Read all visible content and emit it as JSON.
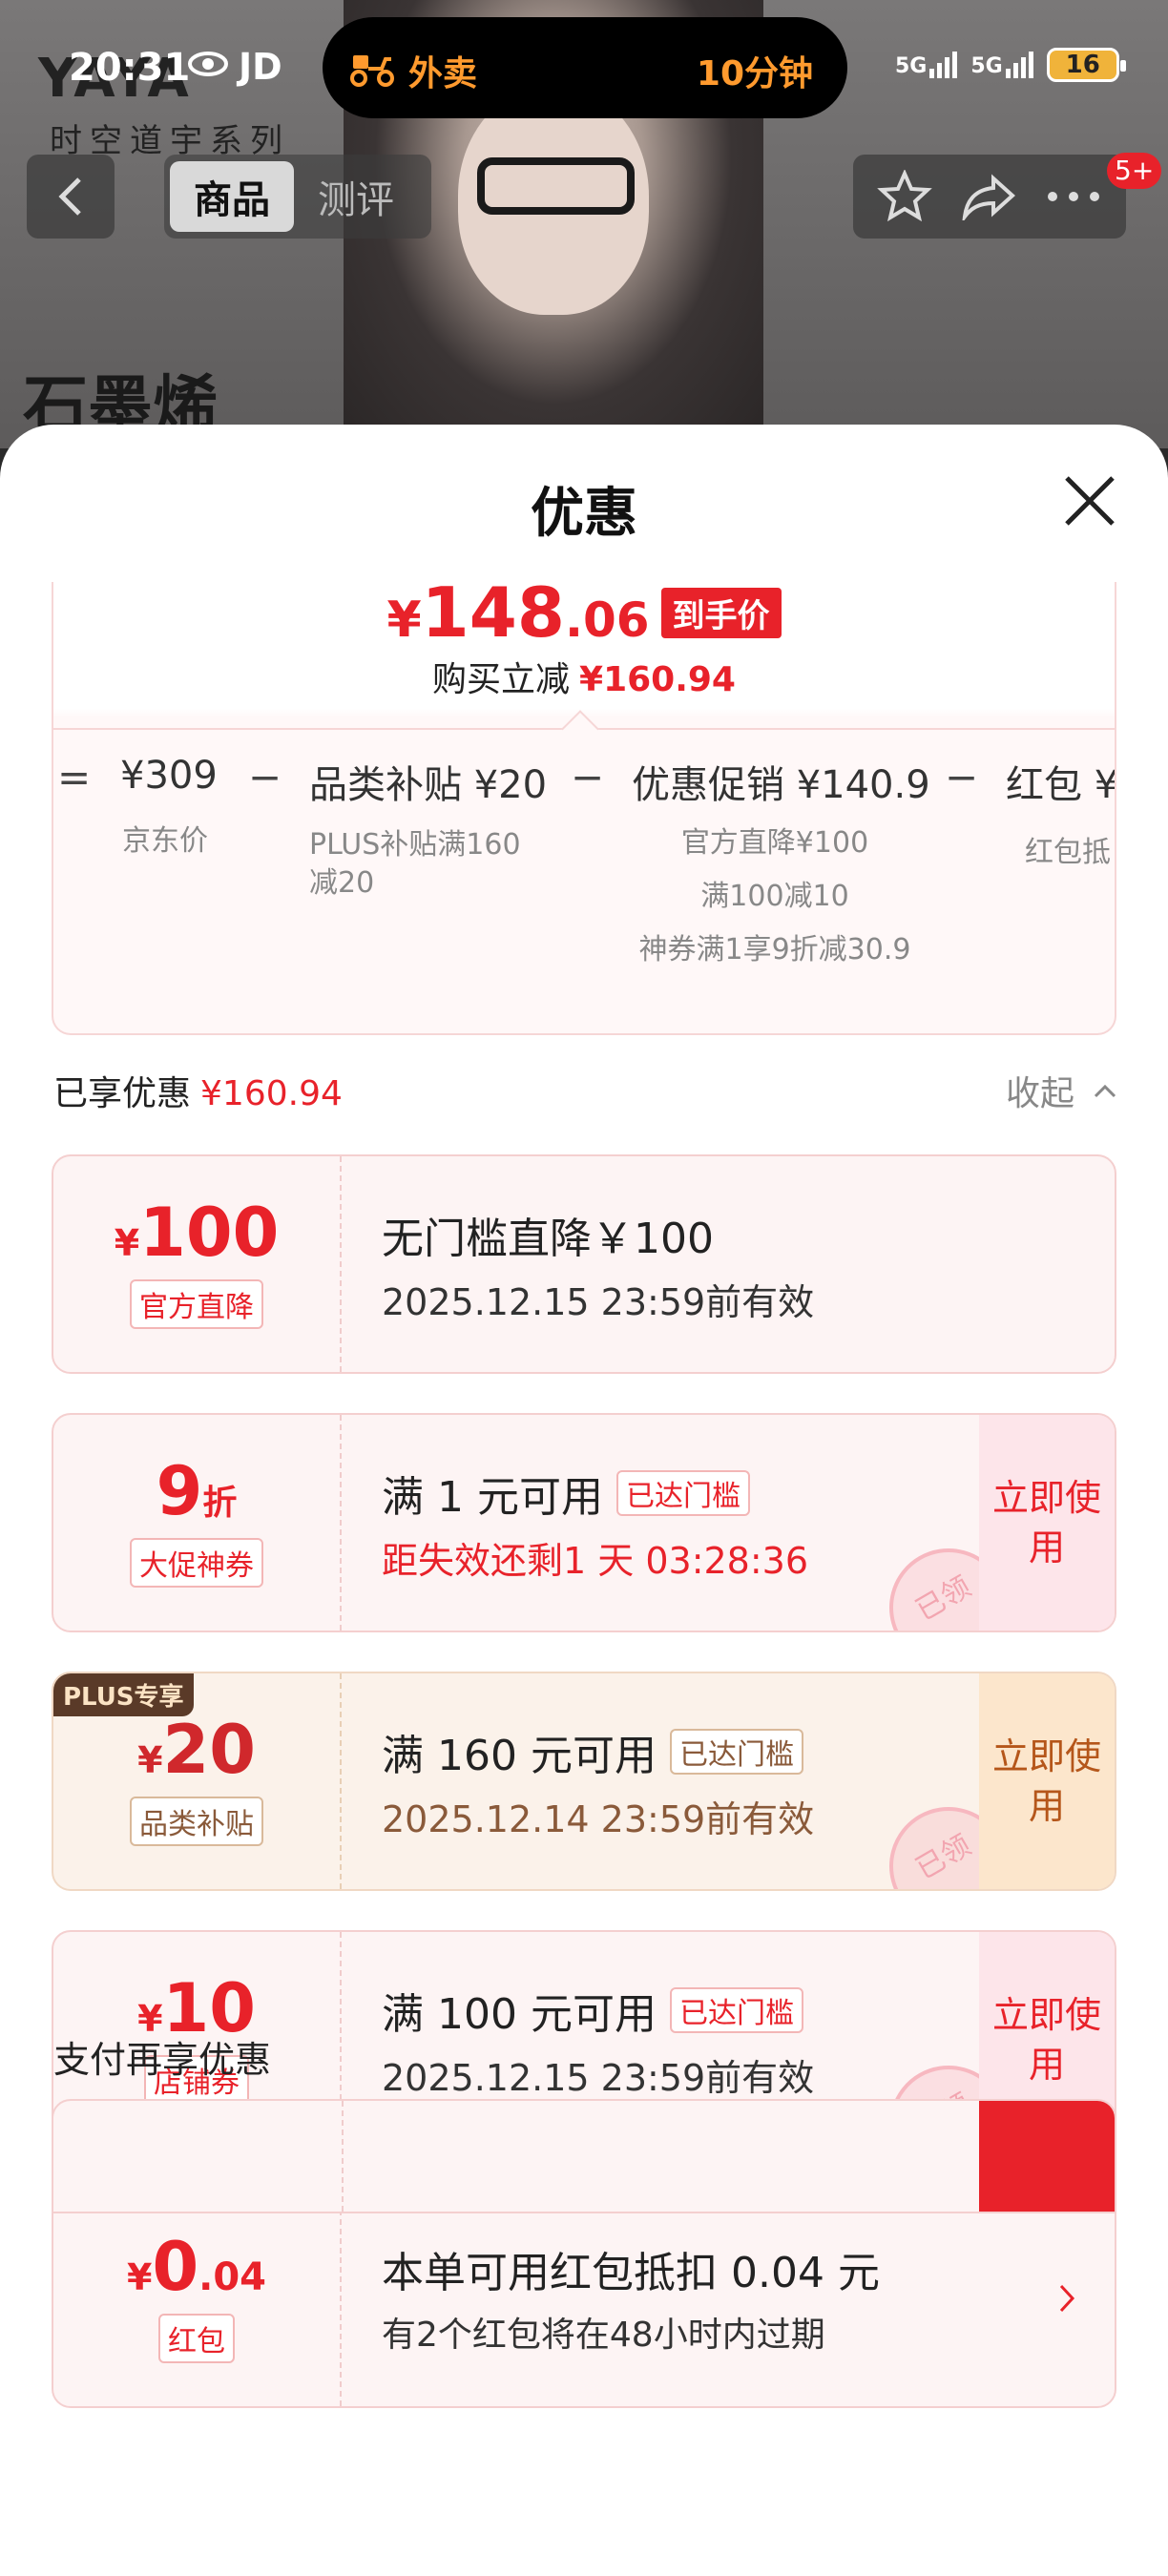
{
  "status_bar": {
    "time": "20:31",
    "carrier_label": "JD",
    "island_label": "外卖",
    "island_eta": "10分钟",
    "signal1": "5G",
    "signal2": "5G",
    "battery": "16"
  },
  "background": {
    "brand": "YAYA",
    "brand_sub": "时空道宇系列",
    "product_title": "石墨烯"
  },
  "nav": {
    "tabs": [
      "商品",
      "测评"
    ],
    "badge": "5+"
  },
  "sheet": {
    "title": "优惠",
    "final_price": {
      "currency": "¥",
      "integer": "148",
      "decimal": ".06",
      "tag": "到手价"
    },
    "save_label": "购买立减",
    "save_amount": "¥160.94",
    "breakdown": [
      {
        "op": "=",
        "main": "¥309",
        "sub": [
          "京东价"
        ]
      },
      {
        "op": "−",
        "main": "品类补贴 ¥20",
        "sub": [
          "PLUS补贴满160",
          "减20"
        ]
      },
      {
        "op": "−",
        "main": "优惠促销 ¥140.9",
        "sub": [
          "官方直降¥100",
          "满100减10",
          "神券满1享9折减30.9"
        ]
      },
      {
        "op": "−",
        "main": "红包 ¥",
        "sub": [
          "红包抵"
        ]
      }
    ],
    "enjoyed_label": "已享优惠",
    "enjoyed_amount": "¥160.94",
    "collapse_label": "收起"
  },
  "coupons": [
    {
      "currency": "¥",
      "big": "100",
      "small": "",
      "kind": "官方直降",
      "main": "无门槛直降￥100",
      "tag": "",
      "sub": "2025.12.15 23:59前有效",
      "sub_red": false,
      "action": "",
      "stamp": ""
    },
    {
      "currency": "",
      "big": "9",
      "small": "折",
      "kind": "大促神券",
      "main": "满 1 元可用",
      "tag": "已达门槛",
      "sub": "距失效还剩1 天 03:28:36",
      "sub_red": true,
      "action": "立即使用",
      "stamp": "已领"
    },
    {
      "currency": "¥",
      "big": "20",
      "small": "",
      "kind": "品类补贴",
      "main": "满 160 元可用",
      "tag": "已达门槛",
      "sub": "2025.12.14 23:59前有效",
      "sub_red": false,
      "action": "立即使用",
      "stamp": "已领",
      "plus_badge": "PLUS专享"
    },
    {
      "currency": "¥",
      "big": "10",
      "small": "",
      "kind": "店铺券",
      "main": "满 100 元可用",
      "tag": "已达门槛",
      "sub": "2025.12.15 23:59前有效",
      "sub_red": false,
      "action": "立即使用",
      "stamp": "已领"
    },
    {
      "currency": "¥",
      "big": "0",
      "small": ".04",
      "kind": "红包",
      "main": "本单可用红包抵扣 0.04 元",
      "tag": "",
      "sub": "有2个红包将在48小时内过期",
      "sub_red": false,
      "action": "",
      "stamp": ""
    }
  ],
  "pay_title": "支付再享优惠",
  "colors": {
    "accent_red": "#e8222a",
    "plus_brown": "#5a3a28",
    "island_orange": "#ff9a2e"
  }
}
